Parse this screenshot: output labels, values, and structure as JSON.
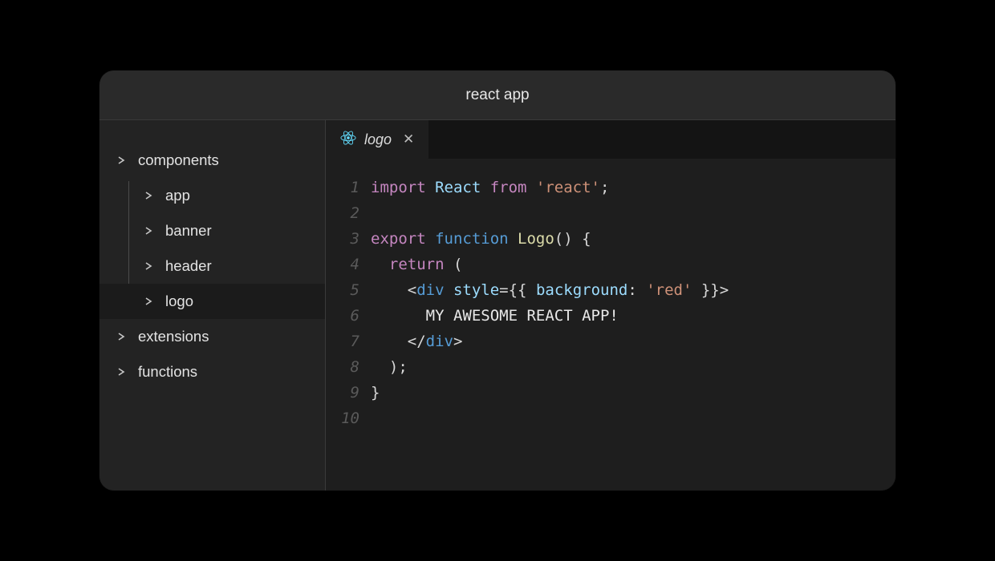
{
  "window": {
    "title": "react app"
  },
  "sidebar": {
    "items": [
      {
        "label": "components",
        "children": [
          {
            "label": "app"
          },
          {
            "label": "banner"
          },
          {
            "label": "header"
          },
          {
            "label": "logo",
            "selected": true
          }
        ]
      },
      {
        "label": "extensions"
      },
      {
        "label": "functions"
      }
    ]
  },
  "tab": {
    "label": "logo",
    "icon": "react-icon"
  },
  "code": {
    "line_count": 10,
    "lines": [
      [
        {
          "t": "import ",
          "c": "kw"
        },
        {
          "t": "React ",
          "c": "name"
        },
        {
          "t": "from ",
          "c": "kw"
        },
        {
          "t": "'react'",
          "c": "str"
        },
        {
          "t": ";",
          "c": "pun"
        }
      ],
      [],
      [
        {
          "t": "export ",
          "c": "kw"
        },
        {
          "t": "function ",
          "c": "tag"
        },
        {
          "t": "Logo",
          "c": "fn"
        },
        {
          "t": "() {",
          "c": "pun"
        }
      ],
      [
        {
          "t": "  ",
          "c": "pun"
        },
        {
          "t": "return ",
          "c": "kw"
        },
        {
          "t": "(",
          "c": "pun"
        }
      ],
      [
        {
          "t": "    <",
          "c": "pun"
        },
        {
          "t": "div ",
          "c": "tag"
        },
        {
          "t": "style",
          "c": "attr"
        },
        {
          "t": "={{ ",
          "c": "pun"
        },
        {
          "t": "background",
          "c": "attr"
        },
        {
          "t": ": ",
          "c": "pun"
        },
        {
          "t": "'red'",
          "c": "str"
        },
        {
          "t": " }}>",
          "c": "pun"
        }
      ],
      [
        {
          "t": "      MY AWESOME REACT APP!",
          "c": "txt"
        }
      ],
      [
        {
          "t": "    </",
          "c": "pun"
        },
        {
          "t": "div",
          "c": "tag"
        },
        {
          "t": ">",
          "c": "pun"
        }
      ],
      [
        {
          "t": "  );",
          "c": "pun"
        }
      ],
      [
        {
          "t": "}",
          "c": "pun"
        }
      ],
      []
    ]
  }
}
